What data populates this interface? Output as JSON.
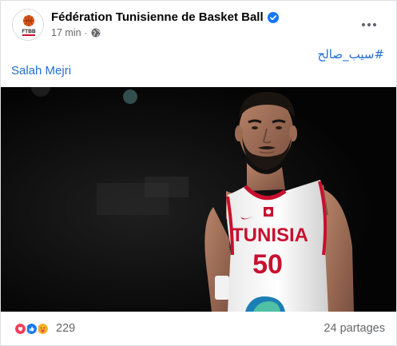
{
  "post": {
    "page_name": "Fédération Tunisienne de Basket Ball",
    "time": "17 min",
    "separator": "·",
    "hashtag": "#سيب_صالح",
    "caption": "Salah Mejri",
    "avatar_text": "FTBB",
    "photo": {
      "jersey_text": "TUNISIA",
      "jersey_number": "50"
    },
    "reactions": {
      "icons": [
        "love-reaction-icon",
        "like-reaction-icon",
        "care-reaction-icon"
      ],
      "count": "229"
    },
    "shares": "24 partages"
  },
  "colors": {
    "link": "#216fdb",
    "meta": "#65676b",
    "verified": "#1877f2",
    "like": "#1877f2",
    "love": "#f33e58",
    "care": "#f7b125",
    "jersey_red": "#c8102e"
  }
}
